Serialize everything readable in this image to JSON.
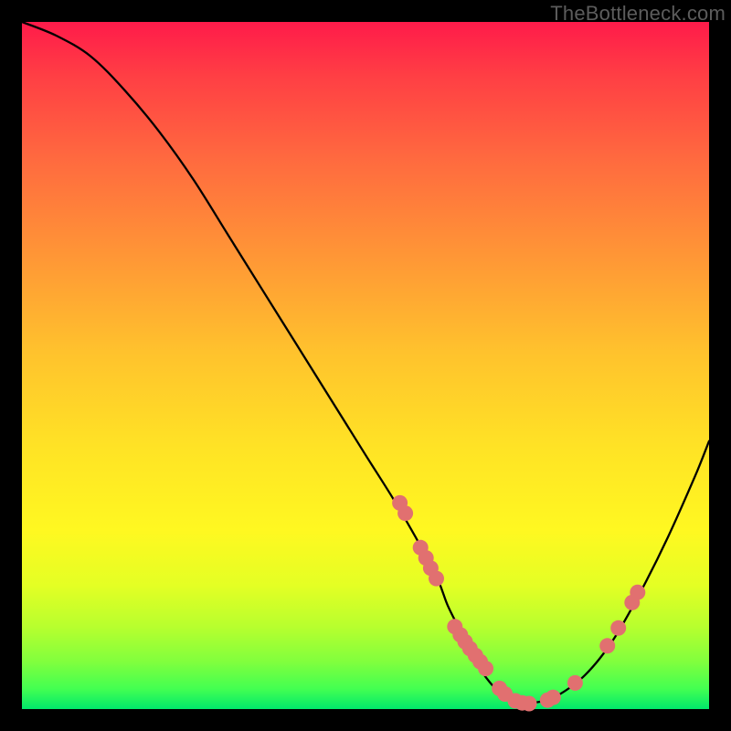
{
  "watermark": "TheBottleneck.com",
  "chart_data": {
    "type": "line",
    "title": "",
    "xlabel": "",
    "ylabel": "",
    "xlim": [
      0,
      100
    ],
    "ylim": [
      0,
      100
    ],
    "series": [
      {
        "name": "bottleneck-curve",
        "x": [
          0,
          5,
          10,
          15,
          20,
          25,
          30,
          35,
          40,
          45,
          50,
          55,
          60,
          62,
          64,
          66,
          68,
          70,
          72,
          75,
          78,
          82,
          86,
          90,
          94,
          98,
          100
        ],
        "y": [
          100,
          98,
          95,
          90,
          84,
          77,
          69,
          61,
          53,
          45,
          37,
          29,
          20,
          15,
          11,
          7,
          4,
          2,
          1,
          1,
          2,
          5,
          10,
          17,
          25,
          34,
          39
        ]
      }
    ],
    "markers": {
      "name": "highlight-dots",
      "color": "#e17070",
      "points": [
        {
          "x": 55.0,
          "y": 30.0
        },
        {
          "x": 55.8,
          "y": 28.5
        },
        {
          "x": 58.0,
          "y": 23.5
        },
        {
          "x": 58.8,
          "y": 22.0
        },
        {
          "x": 59.5,
          "y": 20.5
        },
        {
          "x": 60.3,
          "y": 19.0
        },
        {
          "x": 63.0,
          "y": 12.0
        },
        {
          "x": 63.8,
          "y": 10.8
        },
        {
          "x": 64.5,
          "y": 9.8
        },
        {
          "x": 65.2,
          "y": 8.8
        },
        {
          "x": 66.0,
          "y": 7.8
        },
        {
          "x": 66.7,
          "y": 6.9
        },
        {
          "x": 67.5,
          "y": 5.9
        },
        {
          "x": 69.5,
          "y": 3.0
        },
        {
          "x": 70.3,
          "y": 2.2
        },
        {
          "x": 71.8,
          "y": 1.2
        },
        {
          "x": 72.8,
          "y": 0.9
        },
        {
          "x": 73.8,
          "y": 0.8
        },
        {
          "x": 76.5,
          "y": 1.3
        },
        {
          "x": 77.3,
          "y": 1.7
        },
        {
          "x": 80.5,
          "y": 3.8
        },
        {
          "x": 85.2,
          "y": 9.2
        },
        {
          "x": 86.8,
          "y": 11.8
        },
        {
          "x": 88.8,
          "y": 15.5
        },
        {
          "x": 89.6,
          "y": 17.0
        }
      ]
    }
  }
}
